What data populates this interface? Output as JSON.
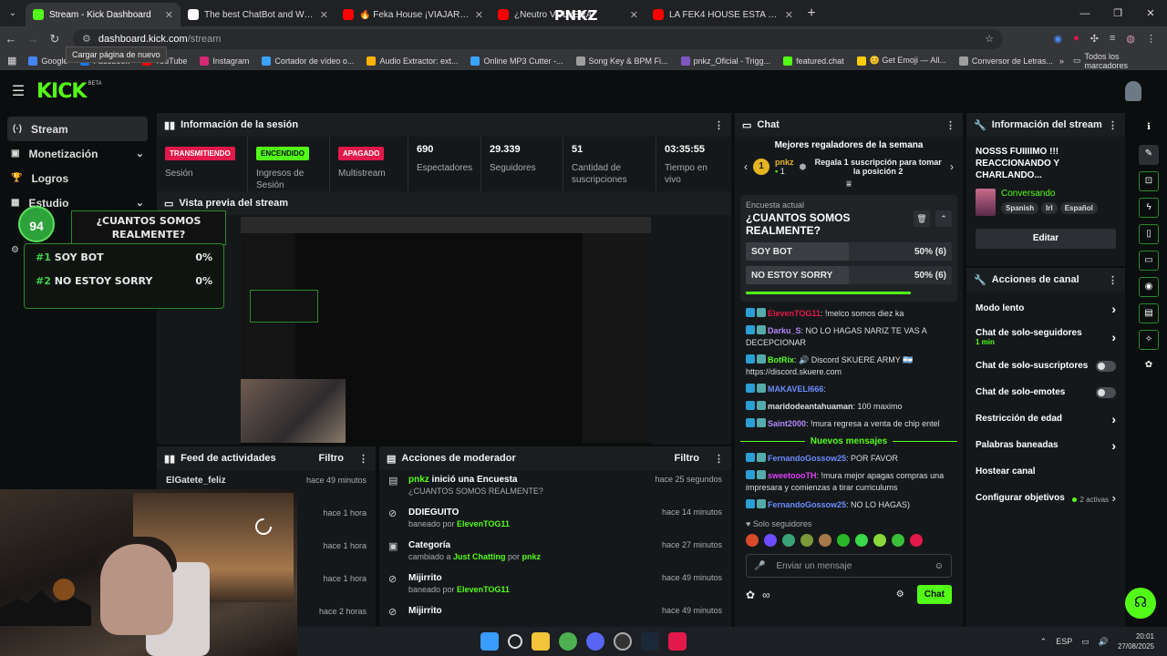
{
  "browser": {
    "tabs": [
      {
        "title": "Stream - Kick Dashboard",
        "color": "#53fc18",
        "active": true
      },
      {
        "title": "The best ChatBot and Widgets",
        "color": "#ffffff",
        "active": false
      },
      {
        "title": "🔥 Feka House ¡VIAJARÁ a BRA",
        "color": "#ff0000",
        "active": false
      },
      {
        "title": "¿Neutro VOLVERÁ",
        "color": "#ff0000",
        "active": false
      },
      {
        "title": "LA FEK4 HOUSE ESTA EN SU PR",
        "color": "#ff0000",
        "active": false
      }
    ],
    "overlay_text": "PNKZ",
    "url_host": "dashboard.kick.com",
    "url_path": "/stream",
    "tooltip": "Cargar página de nuevo",
    "bookmarks": [
      {
        "label": "Google",
        "color": "#4285f4"
      },
      {
        "label": "Facebook",
        "color": "#1877f2"
      },
      {
        "label": "YouTube",
        "color": "#ff0000"
      },
      {
        "label": "Instagram",
        "color": "#d62976"
      },
      {
        "label": "Cortador de vídeo o...",
        "color": "#3aa3ff"
      },
      {
        "label": "Audio Extractor: ext...",
        "color": "#ffb300"
      },
      {
        "label": "Online MP3 Cutter -...",
        "color": "#3aa3ff"
      },
      {
        "label": "Song Key & BPM Fi...",
        "color": "#9e9e9e"
      },
      {
        "label": "pnkz_Oficial - Trigg...",
        "color": "#7e57c2"
      },
      {
        "label": "featured.chat",
        "color": "#53fc18"
      },
      {
        "label": "😊 Get Emoji — All...",
        "color": "#ffcc00"
      },
      {
        "label": "Conversor de Letras...",
        "color": "#9e9e9e"
      }
    ],
    "bookmarks_all": "Todos los marcadores"
  },
  "kick": {
    "logo": "KICK",
    "beta": "BETA"
  },
  "sidebar": {
    "items": [
      {
        "label": "Stream",
        "icon": "(·)"
      },
      {
        "label": "Monetización",
        "icon": "▣"
      },
      {
        "label": "Logros",
        "icon": "🏆"
      },
      {
        "label": "Estudio",
        "icon": "▦"
      }
    ]
  },
  "poll_overlay": {
    "count": "94",
    "question": "¿CUANTOS SOMOS REALMENTE?",
    "options": [
      {
        "num": "#1",
        "label": "SOY BOT",
        "pct": "0%"
      },
      {
        "num": "#2",
        "label": "NO ESTOY SORRY",
        "pct": "0%"
      }
    ]
  },
  "session": {
    "title": "Información de la sesión",
    "stats": [
      {
        "badge": "TRANSMITIENDO",
        "badge_color": "red",
        "label": "Sesión"
      },
      {
        "badge": "ENCENDIDO",
        "badge_color": "green",
        "label": "Ingresos de Sesión"
      },
      {
        "badge": "APAGADO",
        "badge_color": "red",
        "label": "Multistream"
      },
      {
        "value": "690",
        "label": "Espectadores"
      },
      {
        "value": "29.339",
        "label": "Seguidores"
      },
      {
        "value": "51",
        "label": "Cantidad de suscripciones"
      },
      {
        "value": "03:35:55",
        "label": "Tiempo en vivo"
      }
    ]
  },
  "preview": {
    "title": "Vista previa del stream"
  },
  "feed": {
    "title": "Feed de actividades",
    "filter": "Filtro",
    "rows": [
      {
        "name": "ElGatete_feliz",
        "time": "hace 49 minutos"
      },
      {
        "name": "",
        "time": "hace 1 hora"
      },
      {
        "name": "",
        "time": "hace 1 hora"
      },
      {
        "name": "",
        "time": "hace 1 hora"
      },
      {
        "name": "",
        "time": "hace 2 horas"
      }
    ]
  },
  "moderator": {
    "title": "Acciones de moderador",
    "filter": "Filtro",
    "rows": [
      {
        "icon": "▤",
        "actor": "pnkz",
        "title_rest": " inició una Encuesta",
        "sub": "¿CUANTOS SOMOS REALMENTE?",
        "sub_pre": "",
        "sub_actor": "",
        "time": "hace 25 segundos"
      },
      {
        "icon": "⊘",
        "actor": "",
        "title_rest": "DDIEGUITO",
        "sub": "",
        "sub_pre": "baneado por ",
        "sub_actor": "ElevenTOG11",
        "time": "hace 14 minutos"
      },
      {
        "icon": "▣",
        "actor": "",
        "title_rest": "Categoría",
        "sub": "",
        "sub_pre": "cambiado a ",
        "sub_actor": "Just Chatting",
        "sub_mid": " por ",
        "sub_actor2": "pnkz",
        "time": "hace 27 minutos"
      },
      {
        "icon": "⊘",
        "actor": "",
        "title_rest": "Mijirrito",
        "sub": "",
        "sub_pre": "baneado por ",
        "sub_actor": "ElevenTOG11",
        "time": "hace 49 minutos"
      },
      {
        "icon": "⊘",
        "actor": "",
        "title_rest": "Mijirrito",
        "sub": "",
        "sub_pre": "",
        "sub_actor": "",
        "time": "hace 49 minutos"
      }
    ]
  },
  "chat": {
    "title": "Chat",
    "top_gifters": "Mejores regaladores de la semana",
    "gifter": {
      "rank": "1",
      "name": "pnkz",
      "count": "1",
      "cta": "Regala 1 suscripción para tomar la posición 2"
    },
    "poll": {
      "label": "Encuesta actual",
      "question": "¿CUANTOS SOMOS REALMENTE?",
      "options": [
        {
          "label": "SOY BOT",
          "result": "50% (6)",
          "fraction": 0.5
        },
        {
          "label": "NO ESTOY SORRY",
          "result": "50% (6)",
          "fraction": 0.5
        }
      ],
      "timer_fraction": 0.8
    },
    "messages": [
      {
        "user": "ElevenTOG11",
        "color": "#e2194a",
        "text": ": !melco somos diez ka"
      },
      {
        "user": "Darku_S",
        "color": "#b388ff",
        "text": ": NO LO HAGAS NARIZ TE VAS A DECEPCIONAR"
      },
      {
        "user": "BotRix",
        "color": "#53fc18",
        "text": ": 🔊 Discord SKUERE ARMY 🇦🇷 https://discord.skuere.com"
      },
      {
        "user": "MAKAVELI666",
        "color": "#6b8cff",
        "text": ":"
      },
      {
        "user": "maridodeantahuaman",
        "color": "#dddddd",
        "text": ": 100 maximo"
      },
      {
        "user": "Saint2000",
        "color": "#b388ff",
        "text": ": !mura regresa a venta de chip entel"
      }
    ],
    "new_messages": "Nuevos mensajes",
    "messages2": [
      {
        "user": "FernandoGossow25",
        "color": "#6b8cff",
        "text": ": POR FAVOR"
      },
      {
        "user": "sweetooo­TH",
        "color": "#e040fb",
        "text": ": !mura mejor apagas compras una impresara y comienzas a tirar curriculums"
      },
      {
        "user": "FernandoGossow25",
        "color": "#6b8cff",
        "text": ": NO LO HAGAS)"
      }
    ],
    "followers_only": "Solo seguidores",
    "input_placeholder": "Enviar un mensaje",
    "send": "Chat"
  },
  "stream_info": {
    "title": "Información del stream",
    "stream_title": "NOSSS FUIIIIMO !!! REACCIONANDO Y CHARLANDO...",
    "category": "Conversando",
    "tags": [
      "Spanish",
      "Irl",
      "Español"
    ],
    "edit": "Editar"
  },
  "channel_actions": {
    "title": "Acciones de canal",
    "rows": [
      {
        "label": "Modo lento",
        "type": "chevron"
      },
      {
        "label": "Chat de solo-seguidores",
        "sub": "1 min",
        "type": "chevron"
      },
      {
        "label": "Chat de solo-suscriptores",
        "type": "toggle"
      },
      {
        "label": "Chat de solo-emotes",
        "type": "toggle"
      },
      {
        "label": "Restricción de edad",
        "type": "chevron"
      },
      {
        "label": "Palabras baneadas",
        "type": "chevron"
      },
      {
        "label": "Hostear canal",
        "type": "none"
      },
      {
        "label": "Configurar objetivos",
        "type": "goals",
        "extra": "2 activas"
      }
    ]
  },
  "taskbar": {
    "lang": "ESP",
    "time": "20:01",
    "date": "27/08/2025"
  }
}
